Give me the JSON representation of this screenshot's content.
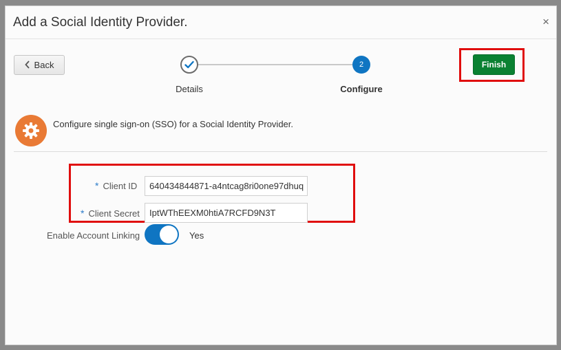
{
  "dialog": {
    "title": "Add a Social Identity Provider.",
    "close_symbol": "×"
  },
  "nav": {
    "back_label": "Back",
    "back_icon": "chevron-left-icon",
    "finish_label": "Finish"
  },
  "stepper": {
    "steps": [
      {
        "label": "Details",
        "state": "completed",
        "icon": "check-icon"
      },
      {
        "label": "Configure",
        "state": "current",
        "number": "2"
      }
    ]
  },
  "info": {
    "icon": "gear-icon",
    "text": "Configure single sign-on (SSO) for a Social Identity Provider."
  },
  "form": {
    "required_marker": "*",
    "client_id": {
      "label": "Client ID",
      "value": "640434844871-a4ntcag8ri0one97dhuq"
    },
    "client_secret": {
      "label": "Client Secret",
      "value": "IptWThEEXM0htiA7RCFD9N3T"
    },
    "account_linking": {
      "label": "Enable Account Linking",
      "value": "Yes",
      "enabled": true
    }
  },
  "colors": {
    "primary_blue": "#0f75c2",
    "finish_green": "#0a8132",
    "highlight_red": "#e00d0d",
    "info_orange": "#e97a35"
  }
}
